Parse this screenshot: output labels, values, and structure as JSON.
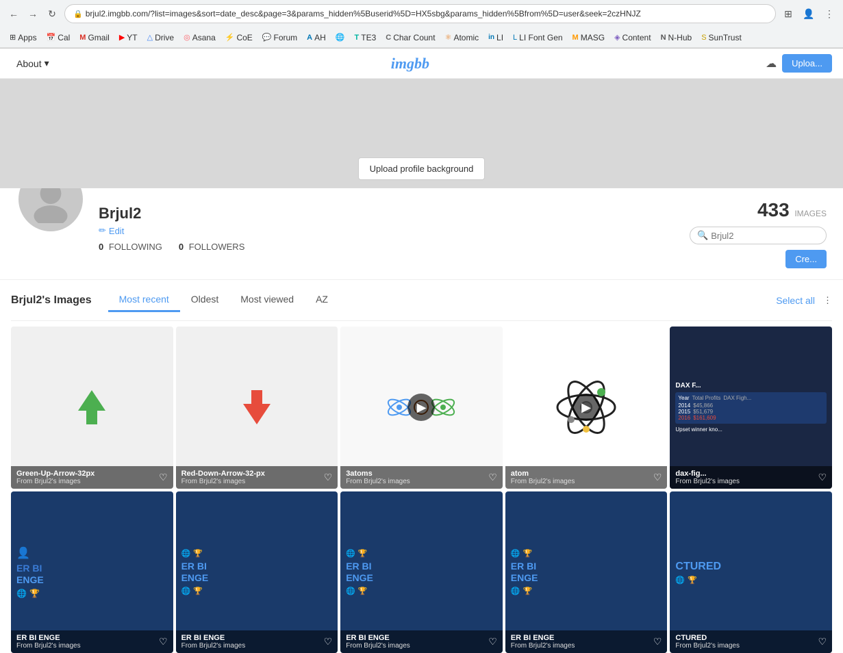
{
  "browser": {
    "back_btn": "←",
    "forward_btn": "→",
    "refresh_btn": "↻",
    "url": "brjul2.imgbb.com/?list=images&sort=date_desc&page=3&params_hidden%5Buserid%5D=HX5sbg&params_hidden%5Bfrom%5D=user&seek=2czHNJZ",
    "extensions_icon": "⊞",
    "profile_icon": "👤",
    "bookmarks": [
      {
        "label": "Apps",
        "icon": "⊞"
      },
      {
        "label": "Cal",
        "icon": "📅"
      },
      {
        "label": "Gmail",
        "icon": "M"
      },
      {
        "label": "YT",
        "icon": "▶"
      },
      {
        "label": "Drive",
        "icon": "△"
      },
      {
        "label": "Asana",
        "icon": "◎"
      },
      {
        "label": "CoE",
        "icon": "⚡"
      },
      {
        "label": "Forum",
        "icon": "💬"
      },
      {
        "label": "AH",
        "icon": "A"
      },
      {
        "label": "",
        "icon": "🌐"
      },
      {
        "label": "TE3",
        "icon": "T"
      },
      {
        "label": "Char Count",
        "icon": "C"
      },
      {
        "label": "Atomic",
        "icon": "⚛"
      },
      {
        "label": "LI",
        "icon": "in"
      },
      {
        "label": "LI Font Gen",
        "icon": "L"
      },
      {
        "label": "MASG",
        "icon": "M"
      },
      {
        "label": "Content",
        "icon": "◈"
      },
      {
        "label": "N-Hub",
        "icon": "N"
      },
      {
        "label": "SunTrust",
        "icon": "S"
      }
    ]
  },
  "nav": {
    "about_label": "About",
    "logo": "imgbb",
    "upload_label": "Uploa..."
  },
  "profile": {
    "upload_bg_label": "Upload profile background",
    "name": "Brjul2",
    "edit_label": "Edit",
    "following_count": "0",
    "following_label": "FOLLOWING",
    "followers_count": "0",
    "followers_label": "FOLLOWERS",
    "images_count": "433",
    "images_label": "IMAGES",
    "search_placeholder": "Brjul2",
    "create_album_label": "Cre..."
  },
  "images_section": {
    "title": "Brjul2's Images",
    "select_all_label": "Select all",
    "tabs": [
      {
        "label": "Most recent",
        "active": true
      },
      {
        "label": "Oldest",
        "active": false
      },
      {
        "label": "Most viewed",
        "active": false
      },
      {
        "label": "AZ",
        "active": false
      }
    ],
    "images": [
      {
        "id": "green-up",
        "title": "Green-Up-Arrow-32px",
        "subtitle": "From Brjul2's images",
        "bg_color": "#f0f0f0",
        "icon_type": "arrow-up",
        "has_play": false
      },
      {
        "id": "red-down",
        "title": "Red-Down-Arrow-32-px",
        "subtitle": "From Brjul2's images",
        "bg_color": "#f0f0f0",
        "icon_type": "arrow-down",
        "has_play": false
      },
      {
        "id": "3atoms",
        "title": "3atoms",
        "subtitle": "From Brjul2's images",
        "bg_color": "#f8f8f8",
        "icon_type": "atoms",
        "has_play": true
      },
      {
        "id": "atom",
        "title": "atom",
        "subtitle": "From Brjul2's images",
        "bg_color": "#ffffff",
        "icon_type": "atom-dark",
        "has_play": true
      },
      {
        "id": "dax",
        "title": "dax-fig...",
        "subtitle": "From Brjul2's images",
        "bg_color": "#1a2744",
        "icon_type": "dax-table",
        "has_play": false
      },
      {
        "id": "bi1",
        "title": "ER BI ENGE",
        "subtitle": "From Brjul2's images",
        "bg_color": "#1a3a6a",
        "icon_type": "bi-card",
        "has_play": false
      },
      {
        "id": "bi2",
        "title": "ER BI ENGE",
        "subtitle": "From Brjul2's images",
        "bg_color": "#1a3a6a",
        "icon_type": "bi-card2",
        "has_play": false
      },
      {
        "id": "bi3",
        "title": "ER BI ENGE",
        "subtitle": "From Brjul2's images",
        "bg_color": "#1a3a6a",
        "icon_type": "bi-card3",
        "has_play": false
      },
      {
        "id": "bi4",
        "title": "ER BI ENGE",
        "subtitle": "From Brjul2's images",
        "bg_color": "#1a3a6a",
        "icon_type": "bi-card4",
        "has_play": false
      },
      {
        "id": "structured",
        "title": "CTURED",
        "subtitle": "From Brjul2's images",
        "bg_color": "#1a3a6a",
        "icon_type": "structured",
        "has_play": false
      }
    ]
  }
}
